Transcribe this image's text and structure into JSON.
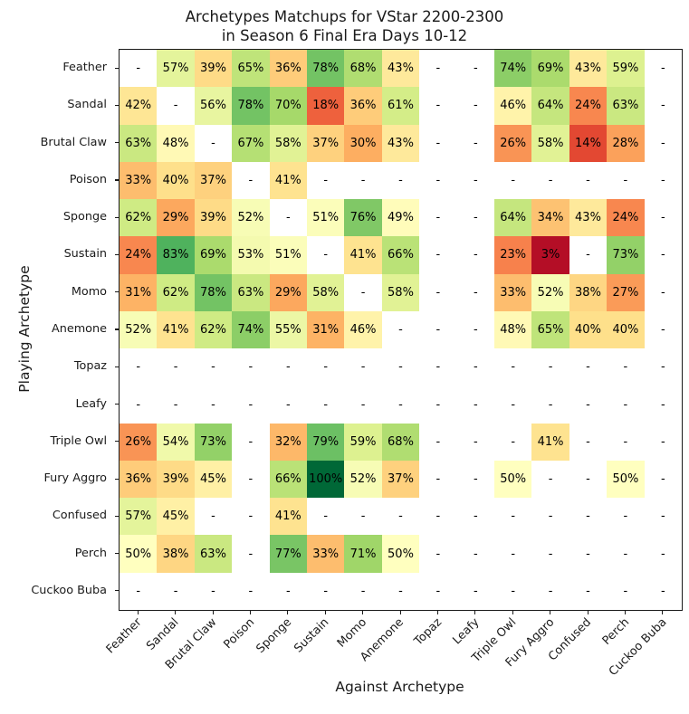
{
  "chart_data": {
    "type": "heatmap",
    "title": "Archetypes Matchups for VStar 2200-2300\nin Season 6 Final Era Days 10-12",
    "xlabel": "Against Archetype",
    "ylabel": "Playing Archetype",
    "missing_symbol": "-",
    "value_suffix": "%",
    "colormap": "RdYlGn",
    "value_range": [
      0,
      100
    ],
    "categories": [
      "Feather",
      "Sandal",
      "Brutal Claw",
      "Poison",
      "Sponge",
      "Sustain",
      "Momo",
      "Anemone",
      "Topaz",
      "Leafy",
      "Triple Owl",
      "Fury Aggro",
      "Confused",
      "Perch",
      "Cuckoo Buba"
    ],
    "x_categories": [
      "Feather",
      "Sandal",
      "Brutal Claw",
      "Poison",
      "Sponge",
      "Sustain",
      "Momo",
      "Anemone",
      "Topaz",
      "Leafy",
      "Triple Owl",
      "Fury Aggro",
      "Confused",
      "Perch",
      "Cuckoo Buba"
    ],
    "y_categories": [
      "Feather",
      "Sandal",
      "Brutal Claw",
      "Poison",
      "Sponge",
      "Sustain",
      "Momo",
      "Anemone",
      "Topaz",
      "Leafy",
      "Triple Owl",
      "Fury Aggro",
      "Confused",
      "Perch",
      "Cuckoo Buba"
    ],
    "rows": [
      {
        "label": "Feather",
        "values": [
          null,
          57,
          39,
          65,
          36,
          78,
          68,
          43,
          null,
          null,
          74,
          69,
          43,
          59,
          null
        ]
      },
      {
        "label": "Sandal",
        "values": [
          42,
          null,
          56,
          78,
          70,
          18,
          36,
          61,
          null,
          null,
          46,
          64,
          24,
          63,
          null
        ]
      },
      {
        "label": "Brutal Claw",
        "values": [
          63,
          48,
          null,
          67,
          58,
          37,
          30,
          43,
          null,
          null,
          26,
          58,
          14,
          28,
          null
        ]
      },
      {
        "label": "Poison",
        "values": [
          33,
          40,
          37,
          null,
          41,
          null,
          null,
          null,
          null,
          null,
          null,
          null,
          null,
          null,
          null
        ]
      },
      {
        "label": "Sponge",
        "values": [
          62,
          29,
          39,
          52,
          null,
          51,
          76,
          49,
          null,
          null,
          64,
          34,
          43,
          24,
          null
        ]
      },
      {
        "label": "Sustain",
        "values": [
          24,
          83,
          69,
          53,
          51,
          null,
          41,
          66,
          null,
          null,
          23,
          3,
          null,
          73,
          null
        ]
      },
      {
        "label": "Momo",
        "values": [
          31,
          62,
          78,
          63,
          29,
          58,
          null,
          58,
          null,
          null,
          33,
          52,
          38,
          27,
          null
        ]
      },
      {
        "label": "Anemone",
        "values": [
          52,
          41,
          62,
          74,
          55,
          31,
          46,
          null,
          null,
          null,
          48,
          65,
          40,
          40,
          null
        ]
      },
      {
        "label": "Topaz",
        "values": [
          null,
          null,
          null,
          null,
          null,
          null,
          null,
          null,
          null,
          null,
          null,
          null,
          null,
          null,
          null
        ]
      },
      {
        "label": "Leafy",
        "values": [
          null,
          null,
          null,
          null,
          null,
          null,
          null,
          null,
          null,
          null,
          null,
          null,
          null,
          null,
          null
        ]
      },
      {
        "label": "Triple Owl",
        "values": [
          26,
          54,
          73,
          null,
          32,
          79,
          59,
          68,
          null,
          null,
          null,
          41,
          null,
          null,
          null
        ]
      },
      {
        "label": "Fury Aggro",
        "values": [
          36,
          39,
          45,
          null,
          66,
          100,
          52,
          37,
          null,
          null,
          50,
          null,
          null,
          50,
          null
        ]
      },
      {
        "label": "Confused",
        "values": [
          57,
          45,
          null,
          null,
          41,
          null,
          null,
          null,
          null,
          null,
          null,
          null,
          null,
          null,
          null
        ]
      },
      {
        "label": "Perch",
        "values": [
          50,
          38,
          63,
          null,
          77,
          33,
          71,
          50,
          null,
          null,
          null,
          null,
          null,
          null,
          null
        ]
      },
      {
        "label": "Cuckoo Buba",
        "values": [
          null,
          null,
          null,
          null,
          null,
          null,
          null,
          null,
          null,
          null,
          null,
          null,
          null,
          null,
          null
        ]
      }
    ],
    "colormap_stops": [
      {
        "t": 0.0,
        "hex": "#a50026"
      },
      {
        "t": 0.1,
        "hex": "#d73027"
      },
      {
        "t": 0.2,
        "hex": "#f46d43"
      },
      {
        "t": 0.3,
        "hex": "#fdae61"
      },
      {
        "t": 0.4,
        "hex": "#fee08b"
      },
      {
        "t": 0.5,
        "hex": "#ffffbf"
      },
      {
        "t": 0.6,
        "hex": "#d9ef8b"
      },
      {
        "t": 0.7,
        "hex": "#a6d96a"
      },
      {
        "t": 0.8,
        "hex": "#66bd63"
      },
      {
        "t": 0.9,
        "hex": "#1a9850"
      },
      {
        "t": 1.0,
        "hex": "#006837"
      }
    ]
  }
}
